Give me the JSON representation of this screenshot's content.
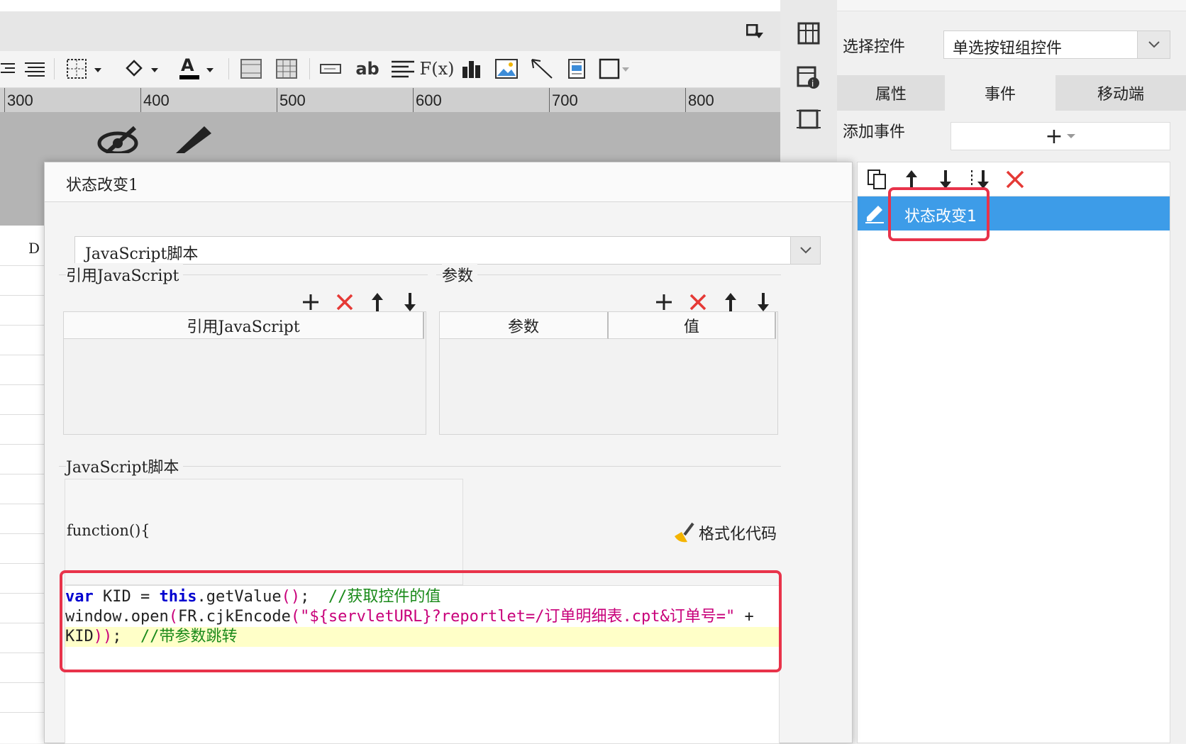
{
  "ruler": {
    "marks": [
      "300",
      "400",
      "500",
      "600",
      "700",
      "800"
    ]
  },
  "sheet": {
    "column": "D"
  },
  "panel": {
    "select_widget_label": "选择控件",
    "select_widget_value": "单选按钮组控件",
    "tabs": [
      "属性",
      "事件",
      "移动端"
    ],
    "add_event_label": "添加事件",
    "add_event_icon": "+",
    "events": [
      {
        "name": "状态改变1"
      }
    ]
  },
  "dialog": {
    "title": "状态改变1",
    "type_value": "JavaScript脚本",
    "ref_js_section": "引用JavaScript",
    "params_section": "参数",
    "ref_js_column": "引用JavaScript",
    "param_column": "参数",
    "value_column": "值",
    "script_section": "JavaScript脚本",
    "function_line": "function(){",
    "format_button": "格式化代码",
    "code": {
      "line1": {
        "kw": "var",
        "a": " KID = ",
        "kw2": "this",
        "b": ".getValue",
        "p": "()",
        "c": ";  ",
        "comment": "//获取控件的值"
      },
      "line2": {
        "a": "window.open",
        "p1": "(",
        "b": "FR.cjkEncode",
        "p2": "(",
        "str": "\"${servletURL}?reportlet=/订单明细表.cpt&订单号=\"",
        "c": " +"
      },
      "line3": {
        "a": "KID",
        "p": "))",
        "c": ";  ",
        "comment": "//带参数跳转"
      }
    }
  }
}
